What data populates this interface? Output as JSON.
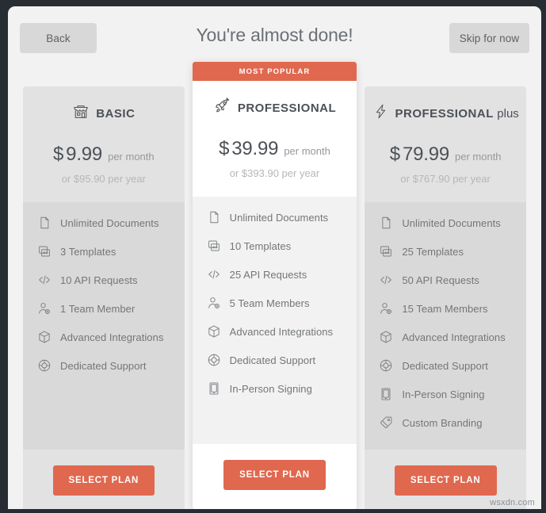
{
  "header": {
    "back_label": "Back",
    "title": "You're almost done!",
    "skip_label": "Skip for now"
  },
  "ribbon_label": "MOST POPULAR",
  "cta_label": "SELECT PLAN",
  "colors": {
    "accent": "#e0684f",
    "page_background": "#f2f2f2",
    "frame": "#282d33",
    "card_side": "#e2e2e2",
    "card_side_features": "#d9d9d9",
    "card_featured": "#ffffff",
    "text_primary": "#4c5056",
    "text_muted": "#95989c",
    "text_faint": "#b4b7ba"
  },
  "plans": [
    {
      "id": "basic",
      "icon": "shop-icon",
      "name": "BASIC",
      "name_suffix": "",
      "currency": "$",
      "price": "9.99",
      "per": "per month",
      "yearly": "or $95.90 per year",
      "featured": false,
      "features": [
        {
          "icon": "document-icon",
          "label": "Unlimited Documents"
        },
        {
          "icon": "template-icon",
          "label": "3 Templates"
        },
        {
          "icon": "code-icon",
          "label": "10 API Requests"
        },
        {
          "icon": "user-add-icon",
          "label": "1 Team Member"
        },
        {
          "icon": "cube-icon",
          "label": "Advanced Integrations"
        },
        {
          "icon": "lifering-icon",
          "label": "Dedicated Support"
        }
      ]
    },
    {
      "id": "professional",
      "icon": "rocket-icon",
      "name": "PROFESSIONAL",
      "name_suffix": "",
      "currency": "$",
      "price": "39.99",
      "per": "per month",
      "yearly": "or $393.90 per year",
      "featured": true,
      "features": [
        {
          "icon": "document-icon",
          "label": "Unlimited Documents"
        },
        {
          "icon": "template-icon",
          "label": "10 Templates"
        },
        {
          "icon": "code-icon",
          "label": "25 API Requests"
        },
        {
          "icon": "user-add-icon",
          "label": "5 Team Members"
        },
        {
          "icon": "cube-icon",
          "label": "Advanced Integrations"
        },
        {
          "icon": "lifering-icon",
          "label": "Dedicated Support"
        },
        {
          "icon": "tablet-icon",
          "label": "In-Person Signing"
        }
      ]
    },
    {
      "id": "professional-plus",
      "icon": "bolt-icon",
      "name": "PROFESSIONAL",
      "name_suffix": "plus",
      "currency": "$",
      "price": "79.99",
      "per": "per month",
      "yearly": "or $767.90 per year",
      "featured": false,
      "features": [
        {
          "icon": "document-icon",
          "label": "Unlimited Documents"
        },
        {
          "icon": "template-icon",
          "label": "25 Templates"
        },
        {
          "icon": "code-icon",
          "label": "50 API Requests"
        },
        {
          "icon": "user-add-icon",
          "label": "15 Team Members"
        },
        {
          "icon": "cube-icon",
          "label": "Advanced Integrations"
        },
        {
          "icon": "lifering-icon",
          "label": "Dedicated Support"
        },
        {
          "icon": "tablet-icon",
          "label": "In-Person Signing"
        },
        {
          "icon": "tag-icon",
          "label": "Custom Branding"
        }
      ]
    }
  ],
  "watermark": "wsxdn.com"
}
